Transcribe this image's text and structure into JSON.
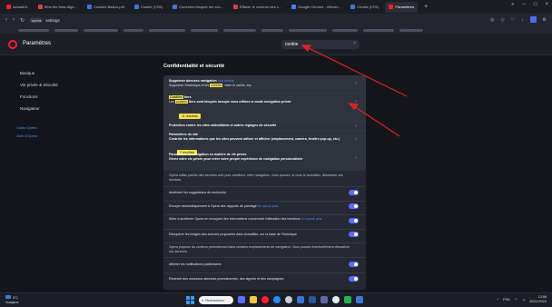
{
  "browser": {
    "tabs": [
      {
        "label": "Actualit.fr",
        "color": "#ff1b2d"
      },
      {
        "label": "Who the New Alge...",
        "color": "#d64545"
      },
      {
        "label": "Cookies Basics.pdf",
        "color": "#3a78d8"
      },
      {
        "label": "Cookie (CPA)",
        "color": "#3a78d8"
      },
      {
        "label": "Comment bloquer les coo...",
        "color": "#3a78d8"
      },
      {
        "label": "Effacer le contenu des c...",
        "color": "#d64545"
      },
      {
        "label": "Google Chrome - effacer...",
        "color": "#4285f4"
      },
      {
        "label": "Cookie (CPA)",
        "color": "#3a78d8"
      },
      {
        "label": "Paramètres",
        "color": "#ff1b2d",
        "active": true
      }
    ],
    "new_tab": "+",
    "address": {
      "chip": "opera",
      "text": "settings"
    }
  },
  "header": {
    "title": "Paramètres",
    "search_value": "cookie",
    "search_clear": "×"
  },
  "sidebar": {
    "items": [
      {
        "label": "Basique"
      },
      {
        "label": "Vie privée & Sécurité"
      },
      {
        "label": "Fonctions"
      },
      {
        "label": "Navigateur"
      }
    ],
    "links": [
      "Outils Opéra",
      "Aide d'Opéra"
    ]
  },
  "main": {
    "section_title": "Confidentialité et sécurité",
    "rows": {
      "clear_title": "Supprimer données navigation",
      "clear_hint": "Voir détails",
      "clear_desc_pre": "Supprimer l'historique et les",
      "clear_desc_hl": "cookies",
      "clear_desc_post": ", vider le cache, etc.",
      "cookies_title_hl": "Cookies",
      "cookies_title_post": " tiers",
      "cookies_desc_pre": "Les",
      "cookies_desc_hl": "cookies",
      "cookies_desc_post": " tiers sont bloqués lorsque vous utilisez le mode navigation privée",
      "tag1": "11 résultats",
      "protection": "Protection contre les sites malveillants et autres réglages de sécurité",
      "site_title": "Paramètres du site",
      "site_desc": "Contrôle les informations que les sites peuvent utiliser et afficher (emplacement, caméra, fenêtre pop-up, etc.)",
      "tag2": "2 résultats",
      "private_title": "Paramètres de navigation en matière de vie privée",
      "private_desc": "Gérez votre vie privée pour créer votre propre expérience de navigation personnalisée",
      "services_intro": "Opera utilise parfois des services web pour améliorer votre navigation. Vous pouvez, si vous le souhaitez, désactiver ces services.",
      "t1": "Améliorer les suggestions de recherche",
      "t2_pre": "Envoyer automatiquement à Opera des rapports de plantage",
      "t2_link": "En savoir plus",
      "t3_pre": "Aider à améliorer Opera en envoyant des informations concernant l'utilisation des fonctions",
      "t3_link": "En savoir plus",
      "t4": "Récupérer les images des sources proposées dans Actualités, sur la base de l'historique",
      "promo_intro": "Opera propose du contenu promotionnel dans certains emplacements de navigateur. Vous pouvez éventuellement désactiver ces services.",
      "t5": "Afficher les notifications publicitaires",
      "t6": "Recevoir des nouveaux abonnés promotionnels, des signets et des campagnes"
    }
  },
  "taskbar": {
    "weather_temp": "9°C",
    "weather_text": "Nuageux",
    "search_label": "Rechercher",
    "lang": "FRA",
    "time": "13:58",
    "date": "25/01/2024"
  },
  "colors": {
    "accent": "#5b6cff",
    "opera_red": "#ff1b2d",
    "highlight": "#f1e34a",
    "annotation": "#e02020"
  }
}
